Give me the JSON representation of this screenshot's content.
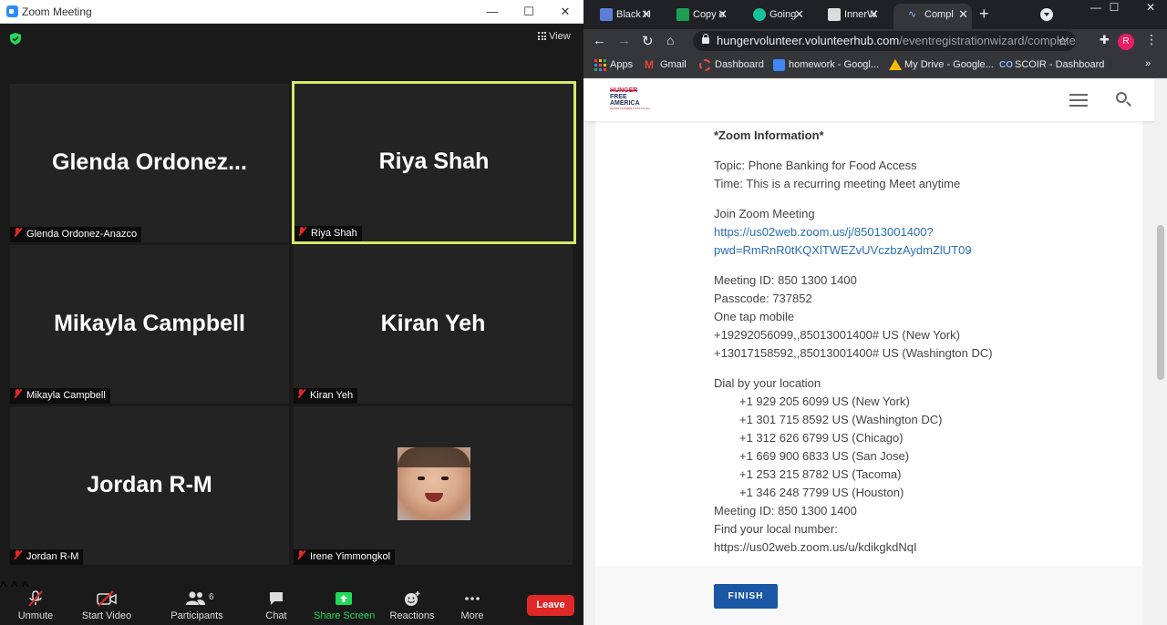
{
  "zoom": {
    "window_title": "Zoom Meeting",
    "view_label": "View",
    "participants_tiles": [
      {
        "display_name": "Glenda  Ordonez...",
        "label": "Glenda Ordonez-Anazco"
      },
      {
        "display_name": "Riya Shah",
        "label": "Riya Shah"
      },
      {
        "display_name": "Mikayla Campbell",
        "label": "Mikayla Campbell"
      },
      {
        "display_name": "Kiran Yeh",
        "label": "Kiran Yeh"
      },
      {
        "display_name": "Jordan R-M",
        "label": "Jordan R-M"
      },
      {
        "display_name": "",
        "label": "Irene Yimmongkol"
      }
    ],
    "toolbar": {
      "unmute": "Unmute",
      "start_video": "Start Video",
      "participants": "Participants",
      "participants_count": "6",
      "chat": "Chat",
      "share_screen": "Share Screen",
      "reactions": "Reactions",
      "more": "More",
      "leave": "Leave"
    },
    "colors": {
      "active_speaker_border": "#d6e86a",
      "share_green": "#23d959",
      "leave_red": "#e02828"
    }
  },
  "chrome": {
    "tabs": [
      {
        "label": "Black H",
        "icon": "calendar-icon"
      },
      {
        "label": "Copy o",
        "icon": "sheets-icon"
      },
      {
        "label": "Going",
        "icon": "grammarly-icon"
      },
      {
        "label": "InnerW",
        "icon": "innerw-icon"
      },
      {
        "label": "Compl",
        "icon": "volunteerhub-icon"
      }
    ],
    "url_domain": "hungervolunteer.volunteerhub.com",
    "url_path": "/eventregistrationwizard/complete",
    "profile_initial": "R",
    "bookmarks": [
      "Apps",
      "Gmail",
      "Dashboard",
      "homework - Googl...",
      "My Drive - Google...",
      "SCOIR - Dashboard"
    ],
    "bookmarks_more": "»"
  },
  "site": {
    "logo_line1": "HUNGER",
    "logo_line2": "FREE",
    "logo_line3": "AMERICA",
    "logo_tagline": "GIVING HUNGER LIFTS US ALL",
    "zoom_heading": "*Zoom Information*",
    "topic": "Topic: Phone Banking for Food Access",
    "time": "Time: This is a recurring meeting Meet anytime",
    "join_label": "Join Zoom Meeting",
    "join_link_1": "https://us02web.zoom.us/j/85013001400?",
    "join_link_2": "pwd=RmRnR0tKQXlTWEZvUVczbzAydmZlUT09",
    "meeting_id": "Meeting ID: 850 1300 1400",
    "passcode": "Passcode: 737852",
    "one_tap": "One tap mobile",
    "tap_1": "+19292056099,,85013001400# US (New York)",
    "tap_2": "+13017158592,,85013001400# US (Washington DC)",
    "dial_label": "Dial by your location",
    "dial_numbers": [
      "+1 929 205 6099 US (New York)",
      "+1 301 715 8592 US (Washington DC)",
      "+1 312 626 6799 US (Chicago)",
      "+1 669 900 6833 US (San Jose)",
      "+1 253 215 8782 US (Tacoma)",
      "+1 346 248 7799 US (Houston)"
    ],
    "meeting_id_2": "Meeting ID: 850 1300 1400",
    "find_local": "Find your local number:",
    "local_link": "https://us02web.zoom.us/u/kdikgkdNqI",
    "finish": "FINISH"
  }
}
